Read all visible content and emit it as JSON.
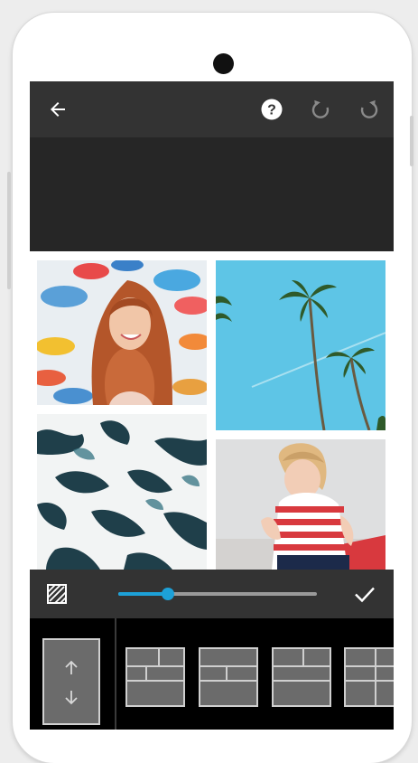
{
  "app": {
    "icons": {
      "back": "arrow-left-icon",
      "help": "help-circle-icon",
      "undo": "undo-icon",
      "redo": "redo-icon",
      "pattern": "pattern-icon",
      "confirm": "check-icon",
      "swap": "swap-vertical-icon"
    },
    "colors": {
      "toolbar": "#333333",
      "accent": "#1da1d8",
      "tray": "#000000"
    },
    "slider": {
      "value": 0.25
    },
    "photos": [
      "umbrella-portrait",
      "palm-trees",
      "ocean-waves",
      "girl-on-beach"
    ],
    "layouts": [
      "layout-1",
      "layout-2",
      "layout-3",
      "layout-4"
    ]
  }
}
